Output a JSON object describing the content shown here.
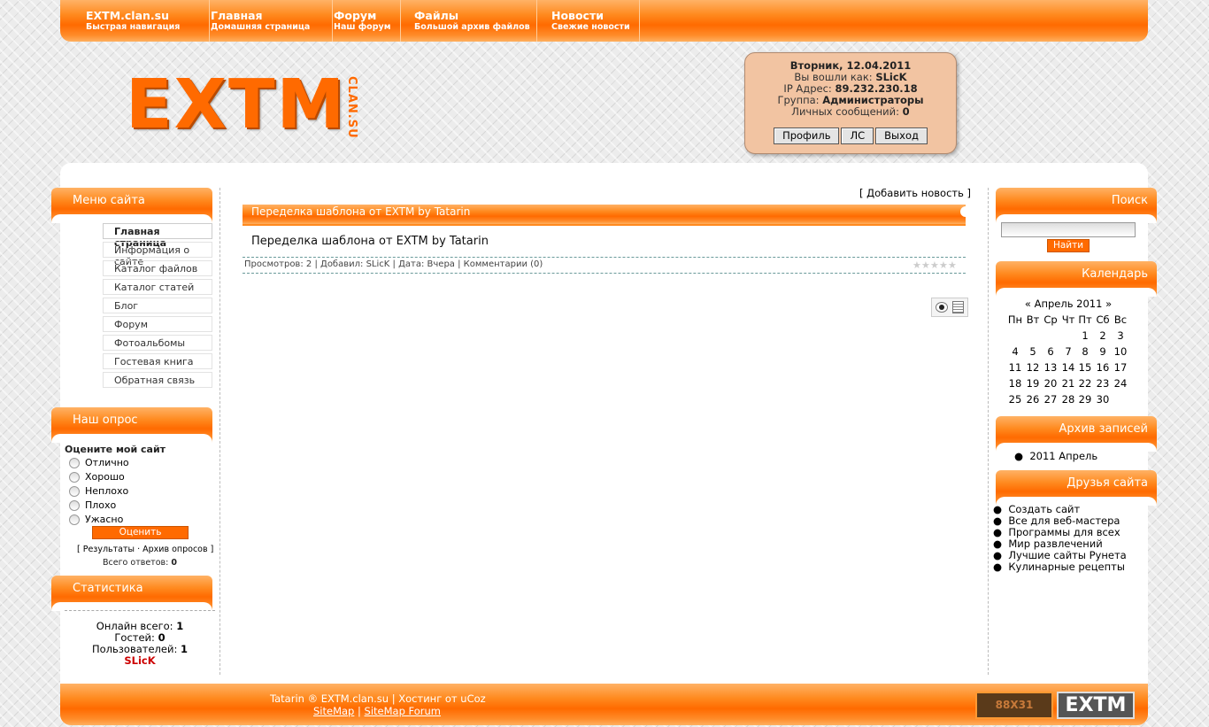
{
  "nav": [
    {
      "title": "EXTM.clan.su",
      "sub": "Быстрая навигация"
    },
    {
      "title": "Главная",
      "sub": "Домашняя страница"
    },
    {
      "title": "Форум",
      "sub": "Наш форум"
    },
    {
      "title": "Файлы",
      "sub": "Большой архив файлов"
    },
    {
      "title": "Новости",
      "sub": "Свежие новости"
    }
  ],
  "logo": {
    "text": "EXTM",
    "sub": "CLAN.SU"
  },
  "user": {
    "date": "Вторник, 12.04.2011",
    "logged_label": "Вы вошли как:",
    "username": "SLicK",
    "ip_label": "IP Адрес:",
    "ip": "89.232.230.18",
    "group_label": "Группа:",
    "group": "Администраторы",
    "messages_label": "Личных сообщений:",
    "messages": "0",
    "buttons": {
      "profile": "Профиль",
      "pm": "ЛС",
      "logout": "Выход"
    }
  },
  "left": {
    "menu_title": "Меню сайта",
    "menu": [
      "Главная страница",
      "Информация о сайте",
      "Каталог файлов",
      "Каталог статей",
      "Блог",
      "Форум",
      "Фотоальбомы",
      "Гостевая книга",
      "Обратная связь"
    ],
    "poll_title": "Наш опрос",
    "poll_question": "Оцените мой сайт",
    "poll_options": [
      "Отлично",
      "Хорошо",
      "Неплохо",
      "Плохо",
      "Ужасно"
    ],
    "poll_button": "Оценить",
    "poll_results": "Результаты",
    "poll_dot": "·",
    "poll_archive": "Архив опросов",
    "poll_total_label": "Всего ответов:",
    "poll_total": "0",
    "stats_title": "Статистика",
    "online_label": "Онлайн всего:",
    "online": "1",
    "guests_label": "Гостей:",
    "guests": "0",
    "users_label": "Пользователей:",
    "users": "1",
    "online_user": "SLicK"
  },
  "center": {
    "add_news": "Добавить новость",
    "news_bar_title": "Переделка шаблона от EXTM by Tatarin",
    "news_title": "Переделка шаблона от EXTM by Tatarin",
    "meta": {
      "views_label": "Просмотров:",
      "views": "2",
      "added_label": "Добавил:",
      "author": "SLicK",
      "date_label": "Дата:",
      "date": "Вчера",
      "comments": "Комментарии (0)"
    },
    "rating_stars": 5
  },
  "right": {
    "search_title": "Поиск",
    "search_button": "Найти",
    "search_value": "",
    "calendar_title": "Календарь",
    "cal_prev": "«",
    "cal_month": "Апрель 2011",
    "cal_next": "»",
    "cal_weekdays": [
      "Пн",
      "Вт",
      "Ср",
      "Чт",
      "Пт",
      "Сб",
      "Вс"
    ],
    "cal_weeks": [
      [
        "",
        "",
        "",
        "",
        "1",
        "2",
        "3"
      ],
      [
        "4",
        "5",
        "6",
        "7",
        "8",
        "9",
        "10"
      ],
      [
        "11",
        "12",
        "13",
        "14",
        "15",
        "16",
        "17"
      ],
      [
        "18",
        "19",
        "20",
        "21",
        "22",
        "23",
        "24"
      ],
      [
        "25",
        "26",
        "27",
        "28",
        "29",
        "30",
        ""
      ]
    ],
    "archive_title": "Архив записей",
    "archive_items": [
      "2011 Апрель"
    ],
    "friends_title": "Друзья сайта",
    "friends": [
      "Создать сайт",
      "Все для веб-мастера",
      "Программы для всех",
      "Мир развлечений",
      "Лучшие сайты Рунета",
      "Кулинарные рецепты"
    ]
  },
  "footer": {
    "copyright": "Tatarin ® EXTM.clan.su | Хостинг от uCoz",
    "sitemap": "SiteMap",
    "sep": "|",
    "sitemap_forum": "SiteMap Forum",
    "banner1": "88X31",
    "banner2": "EXTM"
  },
  "colors": {
    "accent": "#ff6a00",
    "panel": "#f2c4a2",
    "online_user": "#cc0000"
  }
}
